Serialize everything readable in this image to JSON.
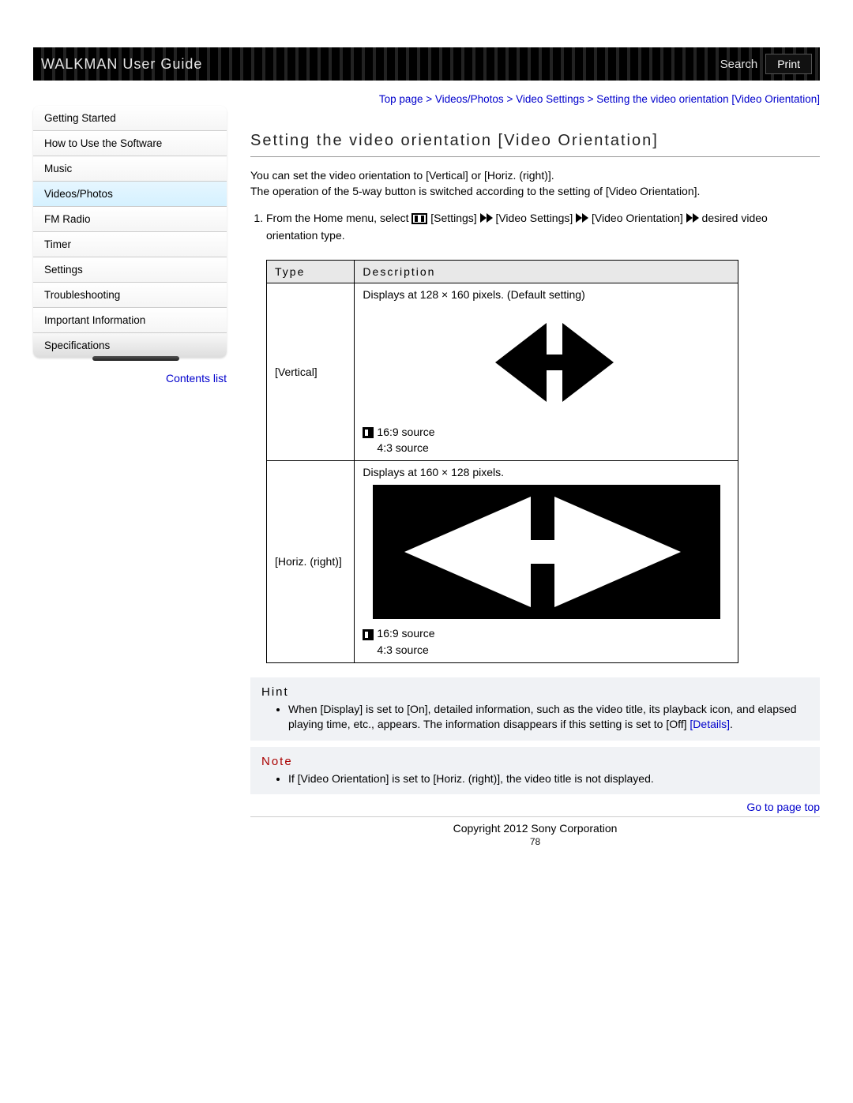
{
  "header": {
    "title": "WALKMAN User Guide",
    "search_label": "Search",
    "print_label": "Print"
  },
  "sidebar": {
    "items": [
      {
        "label": "Getting Started",
        "active": false
      },
      {
        "label": "How to Use the Software",
        "active": false
      },
      {
        "label": "Music",
        "active": false
      },
      {
        "label": "Videos/Photos",
        "active": true
      },
      {
        "label": "FM Radio",
        "active": false
      },
      {
        "label": "Timer",
        "active": false
      },
      {
        "label": "Settings",
        "active": false
      },
      {
        "label": "Troubleshooting",
        "active": false
      },
      {
        "label": "Important Information",
        "active": false
      },
      {
        "label": "Specifications",
        "active": false
      }
    ],
    "contents_list": "Contents list"
  },
  "breadcrumb": {
    "parts": [
      "Top page",
      "Videos/Photos",
      "Video Settings",
      "Setting the video orientation [Video Orientation]"
    ],
    "sep": " > "
  },
  "main": {
    "title": "Setting the video orientation [Video Orientation]",
    "intro1": "You can set the video orientation to [Vertical] or [Horiz. (right)].",
    "intro2": "The operation of the 5-way button is switched according to the setting of [Video Orientation].",
    "step_pre": "From the Home menu, select ",
    "step_settings": " [Settings] ",
    "step_video_settings": " [Video Settings] ",
    "step_video_orientation": " [Video Orientation] ",
    "step_post": " desired video orientation type."
  },
  "table": {
    "col1": "Type",
    "col2": "Description",
    "rows": [
      {
        "type": "[Vertical]",
        "desc_top": "Displays at 128 × 160 pixels. (Default setting)",
        "src1": "16:9 source",
        "src2": "4:3 source"
      },
      {
        "type": "[Horiz. (right)]",
        "desc_top": "Displays at 160 × 128 pixels.",
        "src1": "16:9 source",
        "src2": "4:3 source"
      }
    ]
  },
  "hint": {
    "title": "Hint",
    "text_pre": "When [Display] is set to [On], detailed information, such as the video title, its playback icon, and elapsed playing time, etc., appears. The information disappears if this setting is set to [Off] ",
    "details": "[Details]",
    "text_post": "."
  },
  "note": {
    "title": "Note",
    "text": "If [Video Orientation] is set to [Horiz. (right)], the video title is not displayed."
  },
  "footer": {
    "go_top": "Go to page top",
    "copyright": "Copyright 2012 Sony Corporation",
    "page": "78"
  }
}
